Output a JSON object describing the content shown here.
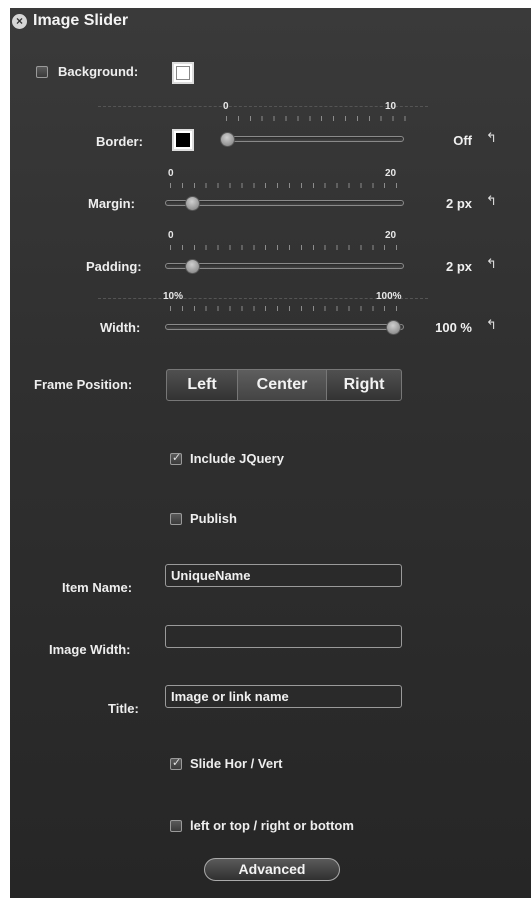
{
  "panel": {
    "title": "Image Slider",
    "close_icon": "close-circle-icon",
    "background": {
      "label": "Background:",
      "checked": false,
      "color": "#ffffff"
    },
    "border": {
      "label": "Border:",
      "color": "#000000",
      "min": "0",
      "max": "10",
      "value": "Off",
      "level": 0.0
    },
    "margin": {
      "label": "Margin:",
      "min": "0",
      "max": "20",
      "value": "2 px",
      "level": 0.1
    },
    "padding": {
      "label": "Padding:",
      "min": "0",
      "max": "20",
      "value": "2 px",
      "level": 0.1
    },
    "width": {
      "label": "Width:",
      "min": "10%",
      "max": "100%",
      "value": "100 %",
      "level": 1.0
    },
    "reset_icon": "reset-arrow-icon",
    "frame_position": {
      "label": "Frame Position:",
      "options": [
        "Left",
        "Center",
        "Right"
      ],
      "selected": "Center"
    },
    "include_jquery": {
      "label": "Include JQuery",
      "checked": true
    },
    "publish": {
      "label": "Publish",
      "checked": false
    },
    "item_name": {
      "label": "Item Name:",
      "value": "UniqueName"
    },
    "image_width": {
      "label": "Image Width:",
      "value": ""
    },
    "title_field": {
      "label": "Title:",
      "value": "Image or link name"
    },
    "slide_hor_vert": {
      "label": "Slide Hor / Vert",
      "checked": true
    },
    "left_or_top": {
      "label": "left or top / right or bottom",
      "checked": false
    },
    "advanced_button": "Advanced"
  }
}
